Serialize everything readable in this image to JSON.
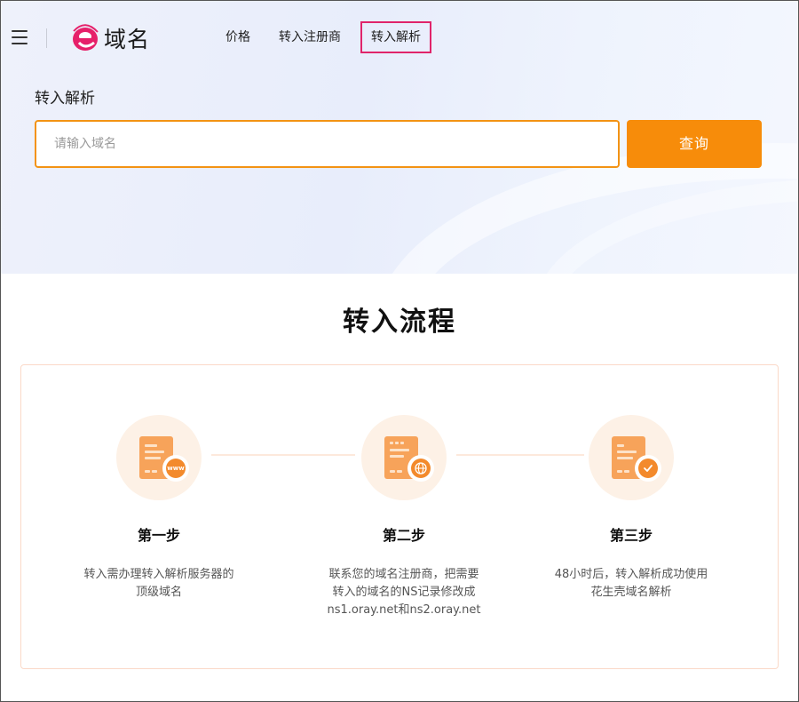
{
  "header": {
    "logo_text": "域名",
    "nav": [
      {
        "label": "价格"
      },
      {
        "label": "转入注册商"
      },
      {
        "label": "转入解析"
      }
    ]
  },
  "hero": {
    "title": "转入解析",
    "search_placeholder": "请输入域名",
    "search_button": "查询"
  },
  "process": {
    "title": "转入流程",
    "steps": [
      {
        "title": "第一步",
        "desc_lines": [
          "转入需办理转入解析服务器的",
          "顶级域名"
        ],
        "icon": "www-icon"
      },
      {
        "title": "第二步",
        "desc_lines": [
          "联系您的域名注册商，把需要",
          "转入的域名的NS记录修改成",
          "ns1.oray.net和ns2.oray.net"
        ],
        "icon": "globe-icon"
      },
      {
        "title": "第三步",
        "desc_lines": [
          "48小时后，转入解析成功使用",
          "花生壳域名解析"
        ],
        "icon": "check-icon"
      }
    ]
  },
  "colors": {
    "accent": "#f78c0a",
    "nav_active_border": "#e0246a",
    "logo": "#e6206a"
  }
}
